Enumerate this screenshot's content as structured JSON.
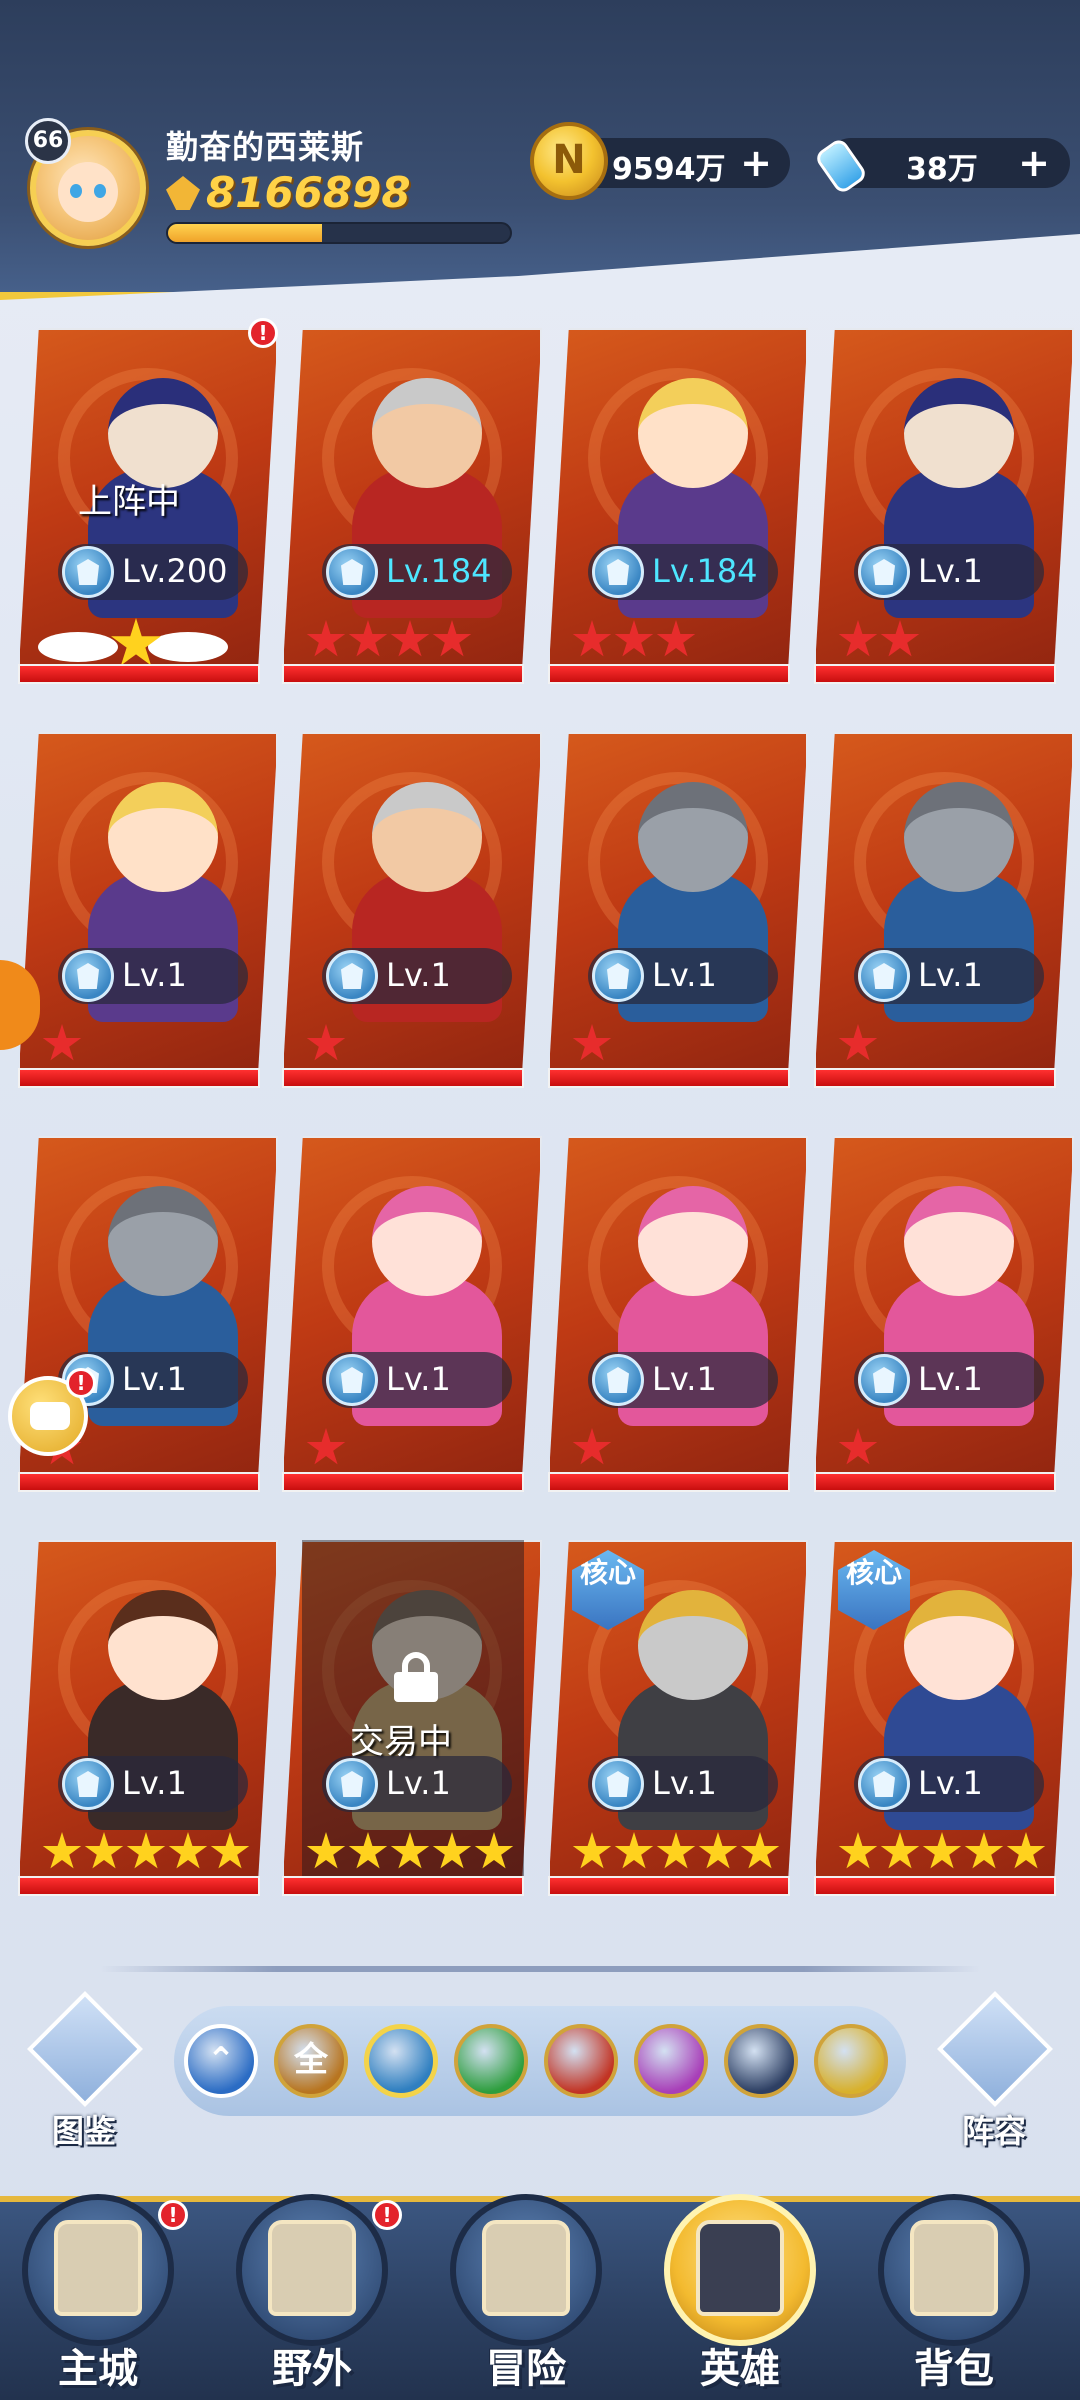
{
  "player": {
    "level": "66",
    "name": "勤奋的西莱斯",
    "power": "8166898",
    "exp_fraction": 0.45
  },
  "resources": {
    "gold": "9594万",
    "potion": "38万",
    "plus": "+"
  },
  "heroes": [
    {
      "lv": "Lv.200",
      "status": "上阵中",
      "stars": 0,
      "wings": true,
      "new_badge": true,
      "theme": "wizard"
    },
    {
      "lv": "Lv.184",
      "high": true,
      "stars": 4,
      "star_color": "red",
      "theme": "fighter"
    },
    {
      "lv": "Lv.184",
      "high": true,
      "stars": 3,
      "star_color": "red",
      "theme": "mage-girl"
    },
    {
      "lv": "Lv.1",
      "stars": 2,
      "star_color": "red",
      "theme": "wizard"
    },
    {
      "lv": "Lv.1",
      "stars": 1,
      "star_color": "red",
      "theme": "mage-girl"
    },
    {
      "lv": "Lv.1",
      "stars": 1,
      "star_color": "red",
      "theme": "fighter"
    },
    {
      "lv": "Lv.1",
      "stars": 1,
      "star_color": "red",
      "theme": "knight"
    },
    {
      "lv": "Lv.1",
      "stars": 1,
      "star_color": "red",
      "theme": "knight"
    },
    {
      "lv": "Lv.1",
      "stars": 1,
      "star_color": "red",
      "theme": "knight"
    },
    {
      "lv": "Lv.1",
      "stars": 1,
      "star_color": "red",
      "theme": "pink"
    },
    {
      "lv": "Lv.1",
      "stars": 1,
      "star_color": "red",
      "theme": "pink"
    },
    {
      "lv": "Lv.1",
      "stars": 1,
      "star_color": "red",
      "theme": "pink"
    },
    {
      "lv": "Lv.1",
      "stars": 5,
      "star_color": "gold",
      "theme": "twin"
    },
    {
      "lv": "Lv.1",
      "status": "交易中",
      "locked": true,
      "stars": 5,
      "star_color": "gold",
      "theme": "hammer"
    },
    {
      "lv": "Lv.1",
      "core": "核心",
      "stars": 5,
      "star_color": "gold",
      "theme": "gold-knight"
    },
    {
      "lv": "Lv.1",
      "core": "核心",
      "stars": 5,
      "star_color": "gold",
      "theme": "blue-girl"
    }
  ],
  "filters": {
    "left_label": "图鉴",
    "right_label": "阵容",
    "buttons": [
      {
        "icon": "collapse-icon",
        "text": "⌃",
        "color": "#2b6cc4"
      },
      {
        "icon": "all-icon",
        "text": "全",
        "color": "#b87520"
      },
      {
        "icon": "helmet-icon",
        "text": "",
        "color": "#2f7fc0"
      },
      {
        "icon": "tree-icon",
        "text": "",
        "color": "#2e9e3e"
      },
      {
        "icon": "demon-icon",
        "text": "",
        "color": "#c23424"
      },
      {
        "icon": "moon-icon",
        "text": "",
        "color": "#a83fb8"
      },
      {
        "icon": "eclipse-icon",
        "text": "",
        "color": "#2d3f63"
      },
      {
        "icon": "sun-icon",
        "text": "",
        "color": "#d8b12c"
      }
    ]
  },
  "nav": [
    {
      "label": "主城",
      "icon": "castle-icon",
      "badge": true
    },
    {
      "label": "野外",
      "icon": "map-scroll-icon",
      "badge": true
    },
    {
      "label": "冒险",
      "icon": "shield-sword-icon",
      "badge": false
    },
    {
      "label": "英雄",
      "icon": "hero-helmet-icon",
      "badge": false,
      "active": true
    },
    {
      "label": "背包",
      "icon": "backpack-icon",
      "badge": false
    }
  ],
  "badge_mark": "!",
  "coin_glyph": "N"
}
